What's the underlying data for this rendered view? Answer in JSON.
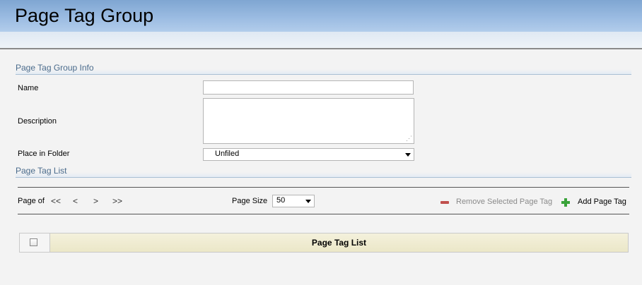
{
  "header": {
    "title": "Page Tag Group"
  },
  "info_section": {
    "title": "Page Tag Group Info",
    "name_label": "Name",
    "name_value": "",
    "description_label": "Description",
    "description_value": "",
    "folder_label": "Place in Folder",
    "folder_value": "Unfiled"
  },
  "list_section": {
    "title": "Page Tag List"
  },
  "pager": {
    "label": "Page of",
    "first": "<<",
    "prev": "<",
    "next": ">",
    "last": ">>",
    "page_size_label": "Page Size",
    "page_size_value": "50"
  },
  "actions": {
    "remove_label": "Remove Selected Page Tag",
    "add_label": "Add Page Tag"
  },
  "grid": {
    "header": "Page Tag List"
  },
  "colors": {
    "accent": "#4a6b8c",
    "remove_icon": "#c0504d",
    "add_icon": "#3aa33a"
  },
  "icons": {
    "remove": "minus-icon",
    "add": "plus-icon",
    "dropdown": "chevron-down-icon"
  }
}
